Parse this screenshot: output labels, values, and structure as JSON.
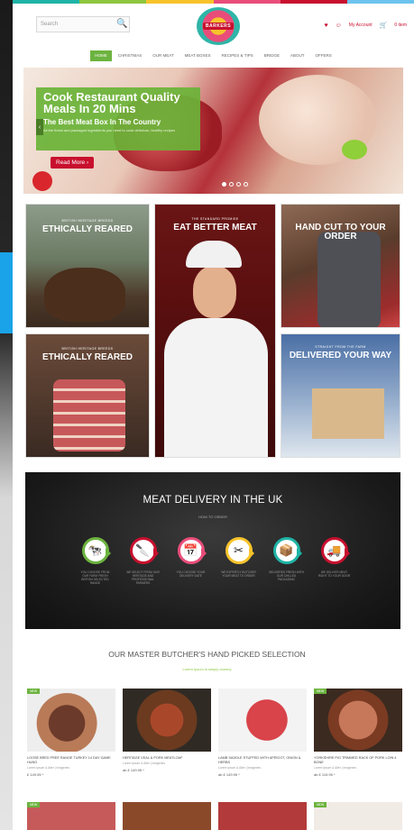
{
  "colors": {
    "accent_green": "#6cb33f",
    "brand_red": "#c8102e",
    "strip": [
      "#1fb4a6",
      "#8dc63f",
      "#f7c32b",
      "#e94d7a",
      "#c8102e",
      "#6cc4ee"
    ]
  },
  "header": {
    "search_placeholder": "Search",
    "logo_text": "BARKERS",
    "my_account": "My Account",
    "cart": "0 item"
  },
  "nav": {
    "items": [
      "Home",
      "Christmas",
      "Our Meat",
      "Meat Boxes",
      "Recipes & Tips",
      "Bridge",
      "About",
      "Offers"
    ]
  },
  "hero": {
    "title": "Cook Restaurant Quality Meals In 20 Mins",
    "subtitle": "The Best Meat Box In The Country",
    "text": "All the finest and packaged ingredients you need to cook delicious, healthy recipes",
    "button": "Read More",
    "slide_count": 4,
    "active_slide": 1
  },
  "tiles": [
    {
      "small": "British heritage breeds",
      "big": "Ethically Reared"
    },
    {
      "small": "The standard promise",
      "big": "Eat Better Meat"
    },
    {
      "small": "",
      "big": "Hand Cut To Your Order"
    },
    {
      "small": "British heritage breeds",
      "big": "Ethically Reared"
    },
    {
      "small": "Straight from the farm",
      "big": "Delivered Your Way"
    }
  ],
  "delivery": {
    "title": "MEAT DELIVERY IN THE UK",
    "subtitle": "How to order",
    "steps": [
      {
        "icon": "cow-icon",
        "glyph": "🐄",
        "color": "#6cb33f",
        "label": "You choose from our farm fresh British selected range"
      },
      {
        "icon": "butcher-icon",
        "glyph": "🔪",
        "color": "#c8102e",
        "label": "We select from our heritage and professional farmers"
      },
      {
        "icon": "calendar-icon",
        "glyph": "📅",
        "color": "#e94d7a",
        "label": "You choose your delivery date"
      },
      {
        "icon": "knife-fork-icon",
        "glyph": "✂",
        "color": "#f7c32b",
        "label": "We expertly butcher your meat to order"
      },
      {
        "icon": "box-icon",
        "glyph": "📦",
        "color": "#1fb4a6",
        "label": "Delivered fresh with our chilled packaging"
      },
      {
        "icon": "truck-icon",
        "glyph": "🚚",
        "color": "#c8102e",
        "label": "We deliver meat right to your door"
      }
    ]
  },
  "selection": {
    "title": "OUR MASTER BUTCHER'S HAND PICKED SELECTION",
    "subtitle": "Lorem Ipsum is simply dummy",
    "products": [
      {
        "badge": "NEW",
        "name": "Loose bred free range turkey 14 day game hung",
        "meta": "Lorem Ipsum & Alter | Imagenes",
        "price": "£ 149.95 *"
      },
      {
        "badge": "",
        "name": "Heritage Veal & Pork Meatloaf",
        "meta": "Lorem Ipsum & Alter | Imagenes",
        "price": "ab £ 149.95 *"
      },
      {
        "badge": "",
        "name": "Lamb saddle stuffed with apricot, onion & herbs",
        "meta": "Lorem Ipsum & Alter | Imagenes",
        "price": "ab £ 149.95 *"
      },
      {
        "badge": "NEW",
        "name": "Yorkshire pig trimmed rack of pork loin 4 bone",
        "meta": "Lorem Ipsum & Alter | Imagenes",
        "price": "ab £ 119.95 *"
      }
    ],
    "row2_badges": [
      "NEW",
      "",
      "",
      "NEW"
    ]
  }
}
